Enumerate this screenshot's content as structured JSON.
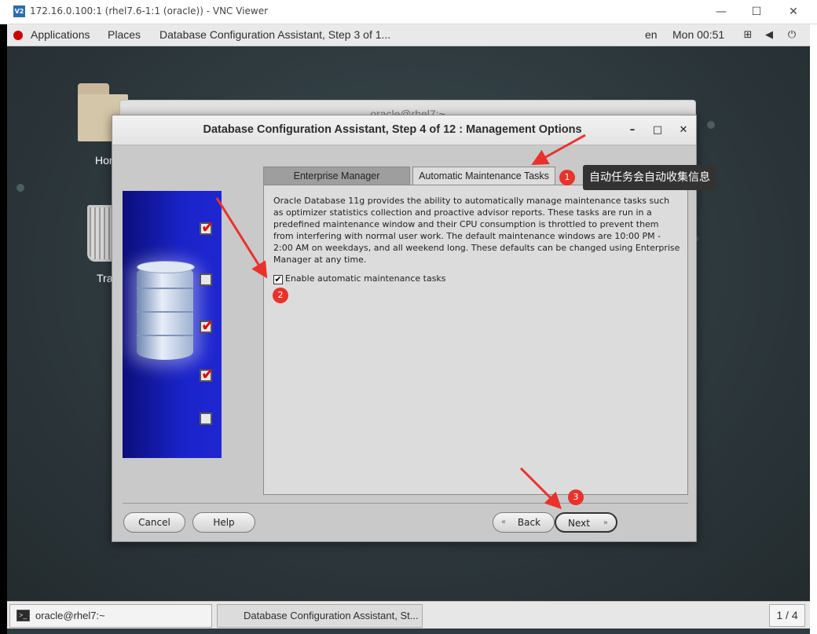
{
  "vnc": {
    "logo": "V2",
    "title": "172.16.0.100:1 (rhel7.6-1:1 (oracle)) - VNC Viewer"
  },
  "topbar": {
    "applications": "Applications",
    "places": "Places",
    "active_window": "Database Configuration Assistant, Step 3 of 1...",
    "language": "en",
    "clock": "Mon 00:51"
  },
  "desktop": {
    "home_label": "Hom",
    "trash_label": "Tra"
  },
  "terminal_window": {
    "title": "oracle@rhel7:~"
  },
  "dbca": {
    "title": "Database Configuration Assistant, Step 4 of 12 : Management Options",
    "steps": [
      {
        "state": "checked"
      },
      {
        "state": "unchecked"
      },
      {
        "state": "checked"
      },
      {
        "state": "checked"
      },
      {
        "state": "unchecked"
      }
    ],
    "tabs": {
      "enterprise_manager": "Enterprise Manager",
      "automatic_maintenance": "Automatic Maintenance Tasks"
    },
    "description": "Oracle Database 11g provides the ability to automatically manage maintenance tasks such as optimizer statistics collection and proactive advisor reports. These tasks are run in a predefined maintenance window and their CPU consumption is throttled to prevent them from interfering with normal user work. The default maintenance windows are 10:00 PM - 2:00 AM on weekdays, and all weekend long. These defaults can be changed using Enterprise Manager at any time.",
    "enable_checkbox": {
      "label": "Enable automatic maintenance tasks",
      "checked": true,
      "mark": "✔"
    },
    "buttons": {
      "cancel": "Cancel",
      "help": "Help",
      "back": "Back",
      "next": "Next"
    }
  },
  "annotations": {
    "badge1": "1",
    "badge2": "2",
    "badge3": "3",
    "tooltip": "自动任务会自动收集信息",
    "color": "#e9322b"
  },
  "taskbar": {
    "terminal": "oracle@rhel7:~",
    "dbca": "Database Configuration Assistant, St...",
    "workspace": "1 / 4"
  }
}
